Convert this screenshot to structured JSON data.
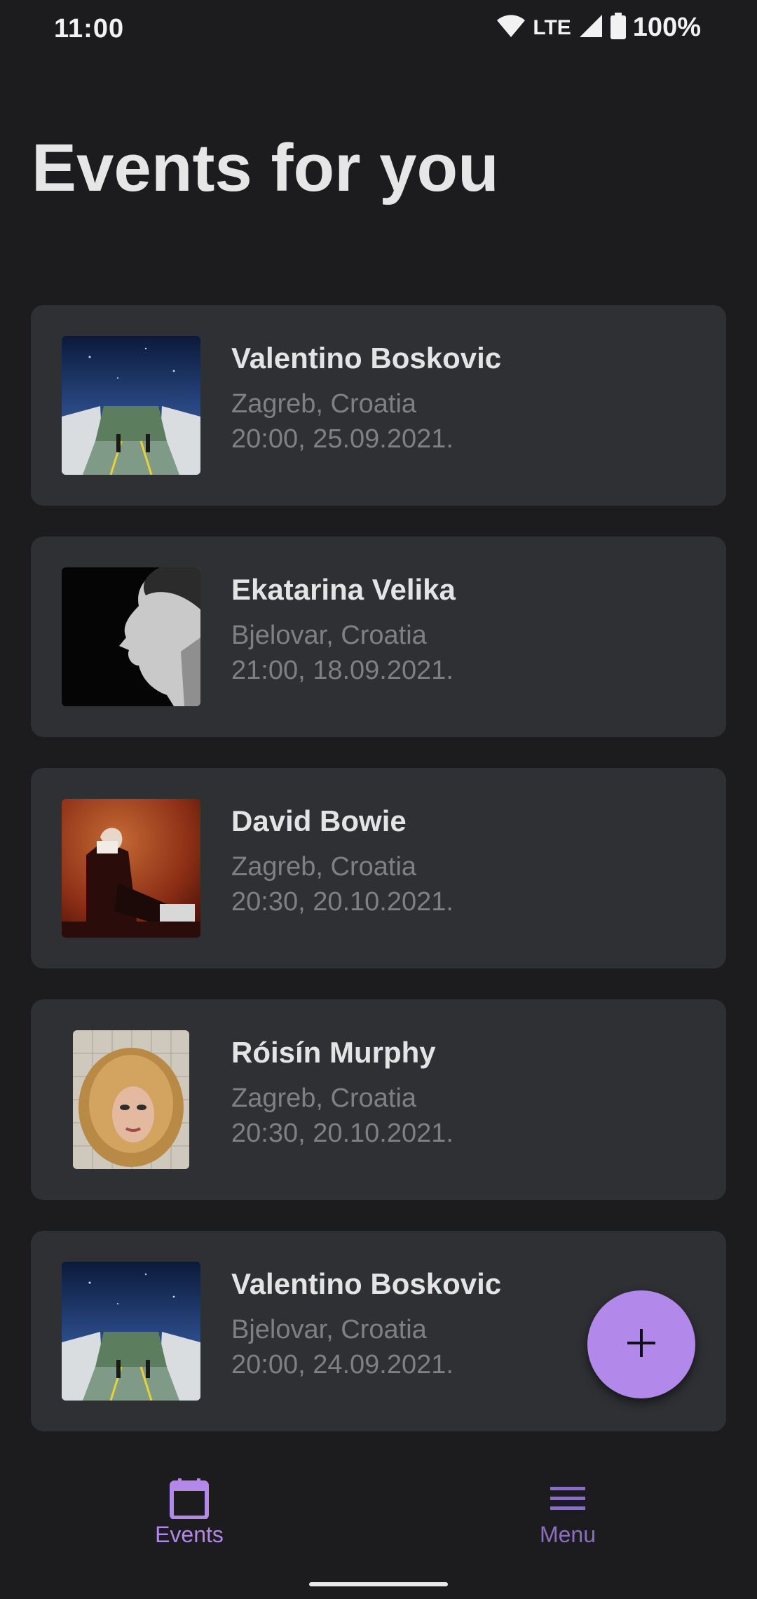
{
  "status_bar": {
    "time": "11:00",
    "network": "LTE",
    "battery": "100%",
    "icons": [
      "wifi-icon",
      "signal-icon",
      "battery-icon"
    ]
  },
  "page": {
    "title": "Events for you"
  },
  "events": [
    {
      "name": "Valentino Boskovic",
      "location": "Zagreb, Croatia",
      "datetime": "20:00, 25.09.2021.",
      "thumbnail": "night-sky-ship-deck"
    },
    {
      "name": "Ekatarina Velika",
      "location": "Bjelovar, Croatia",
      "datetime": "21:00, 18.09.2021.",
      "thumbnail": "profile-portrait-bw"
    },
    {
      "name": "David Bowie",
      "location": "Zagreb, Croatia",
      "datetime": "20:30, 20.10.2021.",
      "thumbnail": "seated-figure-red"
    },
    {
      "name": "Róisín Murphy",
      "location": "Zagreb, Croatia",
      "datetime": "20:30, 20.10.2021.",
      "thumbnail": "curly-hair-portrait"
    },
    {
      "name": "Valentino Boskovic",
      "location": "Bjelovar, Croatia",
      "datetime": "20:00, 24.09.2021.",
      "thumbnail": "night-sky-ship-deck"
    }
  ],
  "fab": {
    "icon": "plus-icon",
    "color": "#b388eb"
  },
  "bottom_nav": {
    "items": [
      {
        "label": "Events",
        "icon": "calendar-icon",
        "active": true
      },
      {
        "label": "Menu",
        "icon": "menu-icon",
        "active": false
      }
    ],
    "accent": "#b388eb"
  },
  "colors": {
    "background": "#1c1c1e",
    "card": "#2e3033",
    "secondary_text": "#7e8084"
  }
}
